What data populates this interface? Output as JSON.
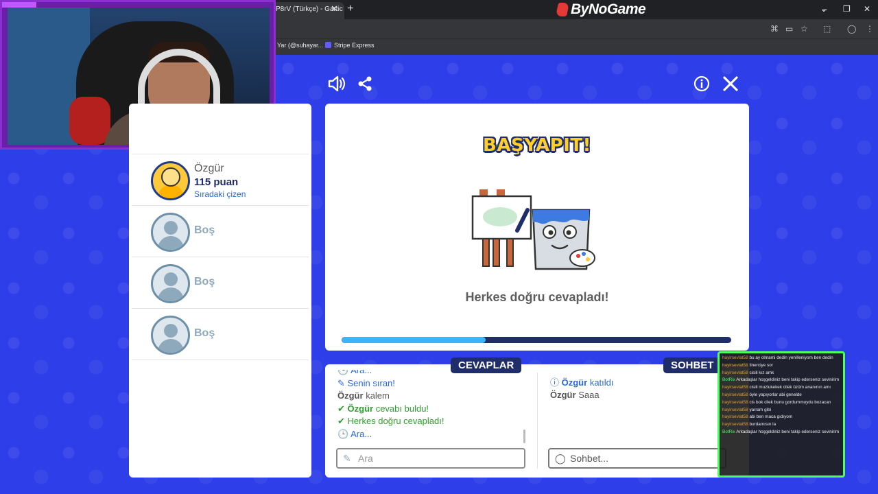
{
  "browser": {
    "tab_title": "P8rV (Türkçe) - Gartic",
    "brand": "ByNoGame",
    "bookmarks": [
      "Yar (@suhayar...",
      "Stripe Express"
    ]
  },
  "game": {
    "title": "BAŞYAPIT!",
    "message": "Herkes doğru cevapladı!",
    "progress": 0.37,
    "colors": {
      "accent": "#1f2d6b",
      "progress": "#3ab4ff",
      "title": "#ffce2a",
      "background": "#2e3ee8"
    }
  },
  "players": [
    {
      "name": "Özgür",
      "score": "115 puan",
      "status": "Sıradaki çizen"
    },
    {
      "name": "Boş"
    },
    {
      "name": "Boş"
    },
    {
      "name": "Boş"
    }
  ],
  "answers": {
    "tab": "CEVAPLAR",
    "lines": [
      {
        "icon": "clock-icon",
        "user": "",
        "text": "Ara..."
      },
      {
        "icon": "pencil-icon",
        "user": "",
        "text": "Senin sıran!"
      },
      {
        "icon": "",
        "user": "Özgür",
        "text": "kalem"
      },
      {
        "icon": "check-icon",
        "user": "Özgür",
        "text": "cevabı buldu!"
      },
      {
        "icon": "check-icon",
        "user": "",
        "text": "Herkes doğru cevapladı!"
      },
      {
        "icon": "clock-icon",
        "user": "",
        "text": "Ara..."
      }
    ],
    "input_placeholder": "Ara"
  },
  "chat": {
    "tab": "SOHBET",
    "lines": [
      {
        "icon": "info-icon",
        "user": "Özgür",
        "text": "katıldı"
      },
      {
        "icon": "",
        "user": "Özgür",
        "text": "Saaa"
      }
    ],
    "input_placeholder": "Sohbet..."
  },
  "stream_chat": [
    {
      "user": "hayirsevlat58",
      "text": "bu ay olmami dedin yenilleniyom ben dedin"
    },
    {
      "user": "hayirsevlat58",
      "text": "tinerciye sor"
    },
    {
      "user": "hayirsevlat58",
      "text": "cisili kız amk"
    },
    {
      "user": "BotRix",
      "text": "Arkadaşlar hoşgeldiniz beni takip ederseniz sevinirim <3",
      "bot": true
    },
    {
      "user": "hayirsevlat58",
      "text": "cisili muzlukekek cilek üzüm ananının amı"
    },
    {
      "user": "hayirsevlat58",
      "text": "öyle yapıyorlar abi genelde"
    },
    {
      "user": "hayirsevlat58",
      "text": "cis bok cilek bunu gordummuydu bozacan"
    },
    {
      "user": "hayirsevlat58",
      "text": "yarram gibi"
    },
    {
      "user": "hayirsevlat58",
      "text": "abi ben maca gıdıyom"
    },
    {
      "user": "hayirsevlat58",
      "text": "burdamısın la"
    },
    {
      "user": "BotRix",
      "text": "Arkadaşlar hoşgeldiniz beni takip ederseniz sevinirim <3",
      "bot": true
    }
  ]
}
